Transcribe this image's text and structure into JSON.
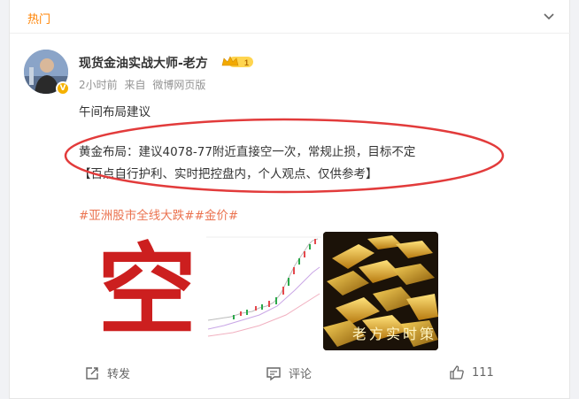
{
  "header": {
    "tab_label": "热门"
  },
  "post": {
    "author": "现货金油实战大师-老方",
    "level_badge": "1",
    "time": "2小时前",
    "source_prefix": "来自",
    "source": "微博网页版",
    "lines": [
      "午间布局建议",
      "黄金布局：建议4078-77附近直接空一次，常规止损，目标不定",
      "【百点自行护利、实时把控盘内，个人观点、仅供参考】"
    ],
    "tags": "#亚洲股市全线大跌##金价#",
    "images": [
      {
        "kind": "text-image",
        "text": "空"
      },
      {
        "kind": "chart-screenshot"
      },
      {
        "kind": "gold-bars-photo",
        "watermark": "老方实时策"
      }
    ]
  },
  "actions": {
    "repost_label": "转发",
    "comment_label": "评论",
    "like_count": "111"
  },
  "colors": {
    "accent": "#ff8200",
    "tag": "#eb7350",
    "highlight_ellipse": "#e23b3b"
  }
}
